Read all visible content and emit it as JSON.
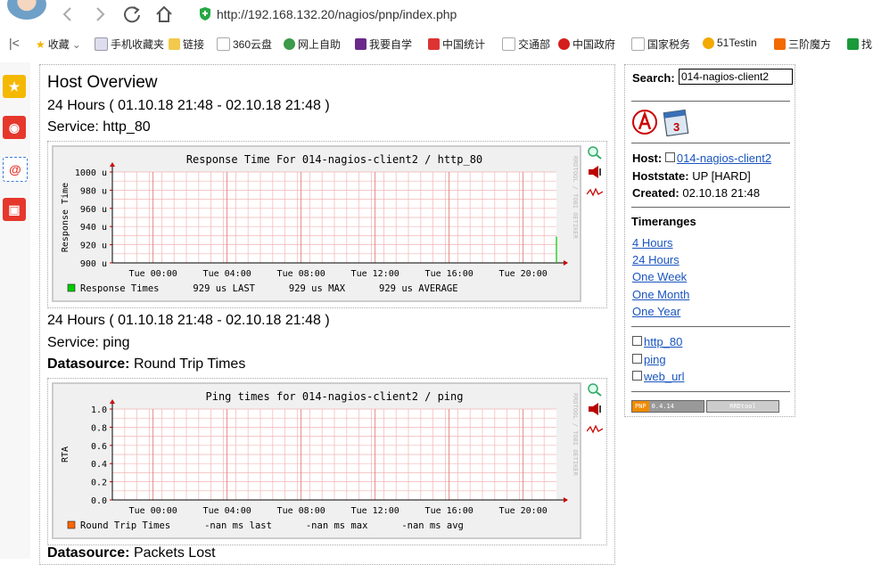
{
  "browser": {
    "url": "http://192.168.132.20/nagios/pnp/index.php",
    "bookmarks": [
      "收藏",
      "手机收藏夹",
      "链接",
      "360云盘",
      "网上自助",
      "我要自学",
      "中国统计",
      "交通部",
      "中国政府",
      "国家税务",
      "51Testin",
      "三阶魔方",
      "找"
    ]
  },
  "main": {
    "title": "Host Overview",
    "sections": [
      {
        "range": "24 Hours ( 01.10.18 21:48 - 02.10.18 21:48 )",
        "service": "Service: http_80",
        "datasource_label": "",
        "datasource_value": ""
      },
      {
        "range": "24 Hours ( 01.10.18 21:48 - 02.10.18 21:48 )",
        "service": "Service: ping",
        "datasource_label": "Datasource:",
        "datasource_value": "Round Trip Times"
      }
    ],
    "bottom_datasource_label": "Datasource:",
    "bottom_datasource_value": "Packets Lost"
  },
  "right": {
    "search_label": "Search:",
    "search_value": "014-nagios-client2",
    "host_label": "Host:",
    "host_value": "014-nagios-client2",
    "hoststate_label": "Hoststate:",
    "hoststate_value": "UP [HARD]",
    "created_label": "Created:",
    "created_value": "02.10.18 21:48",
    "timeranges_heading": "Timeranges",
    "timeranges": [
      "4 Hours",
      "24 Hours",
      "One Week",
      "One Month",
      "One Year"
    ],
    "services": [
      "http_80",
      "ping",
      "web_url"
    ],
    "badge_pnp": "PNP",
    "badge_version": "0.4.14",
    "badge_rrd": "RRDtool"
  },
  "chart_data": [
    {
      "type": "line",
      "title": "Response Time For 014-nagios-client2 / http_80",
      "ylabel": "Response Time",
      "yticks": [
        "1000 u",
        "980 u",
        "960 u",
        "940 u",
        "920 u",
        "900 u"
      ],
      "ylim": [
        900,
        1000
      ],
      "xticks": [
        "Tue 00:00",
        "Tue 04:00",
        "Tue 08:00",
        "Tue 12:00",
        "Tue 16:00",
        "Tue 20:00"
      ],
      "watermark": "RRDTOOL / TOBI OETIKER",
      "series": [
        {
          "name": "Response Times",
          "color": "#00cc00",
          "x": [
            "Tue 21:48"
          ],
          "values": [
            929
          ]
        }
      ],
      "legend": "Response Times      929 us LAST      929 us MAX      929 us AVERAGE"
    },
    {
      "type": "line",
      "title": "Ping times for 014-nagios-client2 / ping",
      "ylabel": "RTA",
      "yticks": [
        "1.0",
        "0.8",
        "0.6",
        "0.4",
        "0.2",
        "0.0"
      ],
      "ylim": [
        0,
        1
      ],
      "xticks": [
        "Tue 00:00",
        "Tue 04:00",
        "Tue 08:00",
        "Tue 12:00",
        "Tue 16:00",
        "Tue 20:00"
      ],
      "watermark": "RRDTOOL / TOBI OETIKER",
      "series": [
        {
          "name": "Round Trip Times",
          "color": "#ff6600",
          "x": [],
          "values": []
        }
      ],
      "legend": "Round Trip Times      -nan ms last      -nan ms max      -nan ms avg"
    }
  ]
}
